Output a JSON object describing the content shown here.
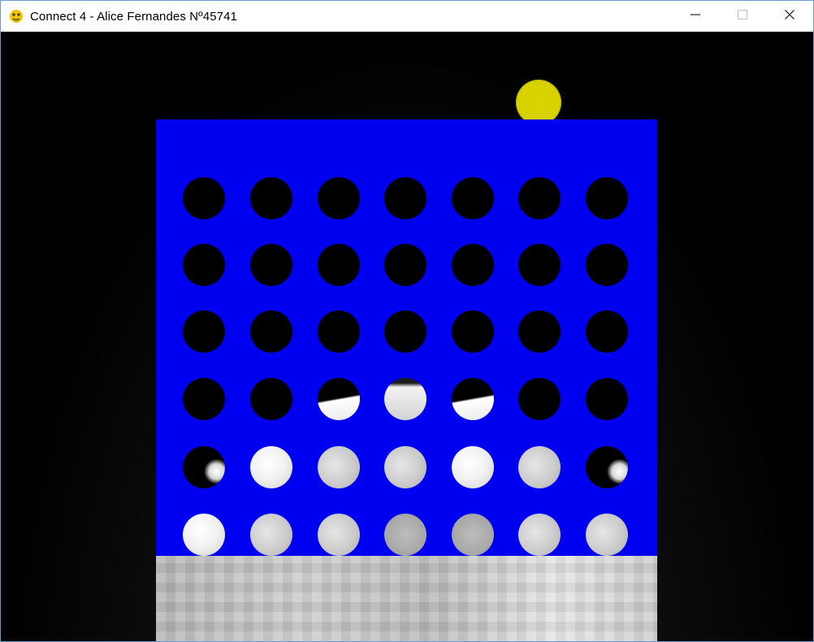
{
  "window": {
    "title": "Connect 4 - Alice Fernandes Nº45741",
    "icons": {
      "app": "pygame-snake-icon",
      "minimize": "minimize-icon",
      "maximize": "maximize-icon",
      "close": "close-icon"
    }
  },
  "game": {
    "preview_disc": {
      "color": "#d9d300",
      "column": 6
    },
    "board": {
      "color": "#0000f0",
      "rows": 6,
      "columns": 7,
      "cells": [
        [
          "empty",
          "empty",
          "empty",
          "empty",
          "empty",
          "empty",
          "empty"
        ],
        [
          "empty",
          "empty",
          "empty",
          "empty",
          "empty",
          "empty",
          "empty"
        ],
        [
          "empty",
          "empty",
          "empty",
          "empty",
          "empty",
          "empty",
          "empty"
        ],
        [
          "empty",
          "empty",
          "half",
          "mostly-w",
          "half",
          "empty",
          "empty"
        ],
        [
          "dark-edge",
          "w1",
          "w2",
          "w2",
          "w1",
          "w2",
          "dark-edge"
        ],
        [
          "w1",
          "w2",
          "w2",
          "w3",
          "w3",
          "w2",
          "w2"
        ]
      ]
    }
  }
}
